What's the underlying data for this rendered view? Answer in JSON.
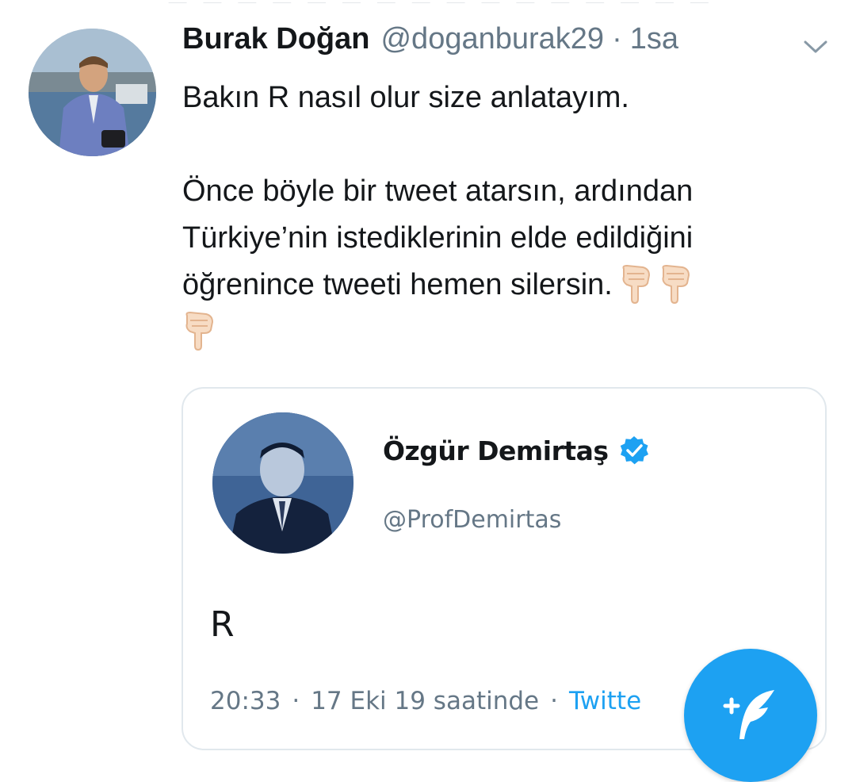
{
  "tweet": {
    "display_name": "Burak Doğan",
    "handle": "@doganburak29",
    "separator": "·",
    "time": "1sa",
    "text_lines": [
      "Bakın R nasıl olur size anlatayım.",
      "",
      "Önce böyle bir tweet atarsın, ardından",
      "Türkiye’nin istediklerinin elde edildiğini",
      "öğrenince tweeti hemen silersin."
    ],
    "emoji": [
      "backhand-index-pointing-down",
      "backhand-index-pointing-down",
      "backhand-index-pointing-down"
    ]
  },
  "quoted": {
    "display_name": "Özgür Demirtaş",
    "handle": "@ProfDemirtas",
    "verified": true,
    "body": "R",
    "time": "20:33",
    "date": "17 Eki 19 saatinde",
    "separator": "·",
    "source": "Twitte"
  },
  "compose_button": {
    "icon": "compose-quill-icon"
  },
  "colors": {
    "accent": "#1da1f2",
    "text": "#14171a",
    "secondary": "#657786",
    "border": "#e1e8ed"
  }
}
